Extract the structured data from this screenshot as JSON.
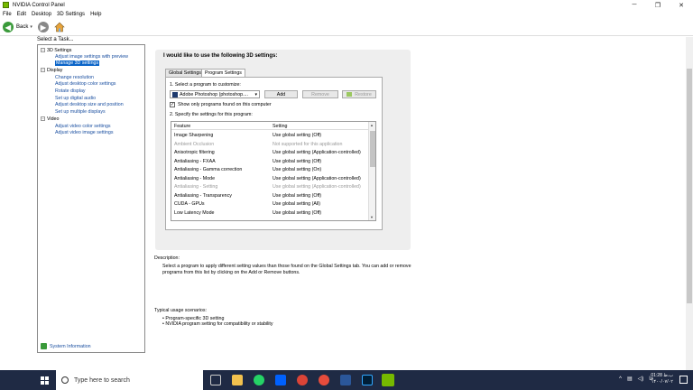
{
  "window": {
    "title": "NVIDIA Control Panel",
    "controls": [
      "─",
      "❐",
      "✕"
    ]
  },
  "menu": [
    "File",
    "Edit",
    "Desktop",
    "3D Settings",
    "Help"
  ],
  "toolbar": {
    "back_label": "Back"
  },
  "left": {
    "select_task": "Select a Task...",
    "tree": [
      {
        "label": "3D Settings",
        "level": 0,
        "toggle": "−"
      },
      {
        "label": "Adjust image settings with preview",
        "level": 1
      },
      {
        "label": "Manage 3D settings",
        "level": 1,
        "selected": true
      },
      {
        "label": "Display",
        "level": 0,
        "toggle": "−"
      },
      {
        "label": "Change resolution",
        "level": 1
      },
      {
        "label": "Adjust desktop color settings",
        "level": 1
      },
      {
        "label": "Rotate display",
        "level": 1
      },
      {
        "label": "Set up digital audio",
        "level": 1
      },
      {
        "label": "Adjust desktop size and position",
        "level": 1
      },
      {
        "label": "Set up multiple displays",
        "level": 1
      },
      {
        "label": "Video",
        "level": 0,
        "toggle": "−"
      },
      {
        "label": "Adjust video color settings",
        "level": 1
      },
      {
        "label": "Adjust video image settings",
        "level": 1
      }
    ],
    "system_info": "System Information"
  },
  "main": {
    "heading": "I would like to use the following 3D settings:",
    "tabs": [
      "Global Settings",
      "Program Settings"
    ],
    "step1": "1. Select a program to customize:",
    "program_selected": "Adobe Photoshop (photoshop....",
    "buttons": {
      "add": "Add",
      "remove": "Remove",
      "restore": "Restore"
    },
    "show_only": "Show only programs found on this computer",
    "step2": "2. Specify the settings for this program:",
    "table_headers": {
      "feature": "Feature",
      "setting": "Setting"
    },
    "rows": [
      {
        "feature": "Image Sharpening",
        "setting": "Use global setting (Off)",
        "disabled": false
      },
      {
        "feature": "Ambient Occlusion",
        "setting": "Not supported for this application",
        "disabled": true
      },
      {
        "feature": "Anisotropic filtering",
        "setting": "Use global setting (Application-controlled)",
        "disabled": false
      },
      {
        "feature": "Antialiasing - FXAA",
        "setting": "Use global setting (Off)",
        "disabled": false
      },
      {
        "feature": "Antialiasing - Gamma correction",
        "setting": "Use global setting (On)",
        "disabled": false
      },
      {
        "feature": "Antialiasing - Mode",
        "setting": "Use global setting (Application-controlled)",
        "disabled": false
      },
      {
        "feature": "Antialiasing - Setting",
        "setting": "Use global setting (Application-controlled)",
        "disabled": true
      },
      {
        "feature": "Antialiasing - Transparency",
        "setting": "Use global setting (Off)",
        "disabled": false
      },
      {
        "feature": "CUDA - GPUs",
        "setting": "Use global setting (All)",
        "disabled": false
      },
      {
        "feature": "Low Latency Mode",
        "setting": "Use global setting (Off)",
        "disabled": false
      }
    ],
    "description_label": "Description:",
    "description_text": "Select a program to apply different setting values than those found on the Global Settings tab. You can add or remove programs from this list by clicking on the Add or Remove buttons.",
    "usage_label": "Typical usage scenarios:",
    "usage_items": [
      "• Program-specific 3D setting",
      "• NVIDIA program setting for compatibility or stability"
    ]
  },
  "taskbar": {
    "search_placeholder": "Type here to search",
    "clock_time": "01:28 ب.ظ",
    "clock_date": "۱۴۰۰/۰۷/۰۲",
    "lang": "فا"
  }
}
